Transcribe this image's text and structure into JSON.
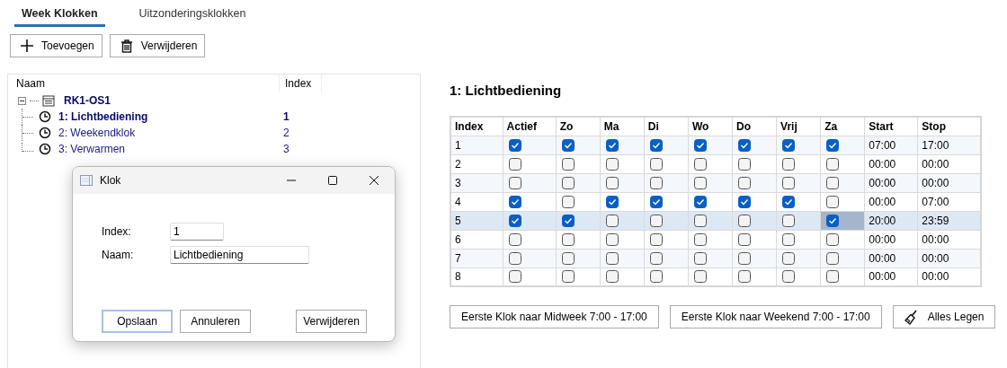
{
  "tabs": [
    {
      "label": "Week Klokken",
      "selected": true
    },
    {
      "label": "Uitzonderingsklokken",
      "selected": false
    }
  ],
  "toolbar": [
    {
      "kind": "add",
      "label": "Toevoegen"
    },
    {
      "kind": "delete",
      "label": "Verwijderen"
    }
  ],
  "tree": {
    "columns": [
      "Naam",
      "Index"
    ],
    "root": {
      "label": "RK1-OS1",
      "expanded": true,
      "children": [
        {
          "label": "1: Lichtbediening",
          "index": "1",
          "selected": true
        },
        {
          "label": "2: Weekendklok",
          "index": "2",
          "selected": false
        },
        {
          "label": "3: Verwarmen",
          "index": "3",
          "selected": false
        }
      ]
    }
  },
  "schedule": {
    "title": "1: Lichtbediening",
    "columns": [
      "Index",
      "Actief",
      "Zo",
      "Ma",
      "Di",
      "Wo",
      "Do",
      "Vrij",
      "Za",
      "Start",
      "Stop"
    ],
    "rows": [
      {
        "index": "1",
        "selected": false,
        "checks": [
          {
            "checked": true,
            "focused": false
          },
          {
            "checked": true,
            "focused": false
          },
          {
            "checked": true,
            "focused": false
          },
          {
            "checked": true,
            "focused": false
          },
          {
            "checked": true,
            "focused": false
          },
          {
            "checked": true,
            "focused": false
          },
          {
            "checked": true,
            "focused": false
          },
          {
            "checked": true,
            "focused": false
          }
        ],
        "start": "07:00",
        "stop": "17:00"
      },
      {
        "index": "2",
        "selected": false,
        "checks": [
          {
            "checked": false,
            "focused": false
          },
          {
            "checked": false,
            "focused": false
          },
          {
            "checked": false,
            "focused": false
          },
          {
            "checked": false,
            "focused": false
          },
          {
            "checked": false,
            "focused": false
          },
          {
            "checked": false,
            "focused": false
          },
          {
            "checked": false,
            "focused": false
          },
          {
            "checked": false,
            "focused": false
          }
        ],
        "start": "00:00",
        "stop": "00:00"
      },
      {
        "index": "3",
        "selected": false,
        "checks": [
          {
            "checked": false,
            "focused": false
          },
          {
            "checked": false,
            "focused": false
          },
          {
            "checked": false,
            "focused": false
          },
          {
            "checked": false,
            "focused": false
          },
          {
            "checked": false,
            "focused": false
          },
          {
            "checked": false,
            "focused": false
          },
          {
            "checked": false,
            "focused": false
          },
          {
            "checked": false,
            "focused": false
          }
        ],
        "start": "00:00",
        "stop": "00:00"
      },
      {
        "index": "4",
        "selected": false,
        "checks": [
          {
            "checked": true,
            "focused": false
          },
          {
            "checked": false,
            "focused": false
          },
          {
            "checked": true,
            "focused": false
          },
          {
            "checked": true,
            "focused": false
          },
          {
            "checked": true,
            "focused": false
          },
          {
            "checked": true,
            "focused": false
          },
          {
            "checked": true,
            "focused": false
          },
          {
            "checked": false,
            "focused": false
          }
        ],
        "start": "00:00",
        "stop": "07:00"
      },
      {
        "index": "5",
        "selected": true,
        "checks": [
          {
            "checked": true,
            "focused": false
          },
          {
            "checked": true,
            "focused": false
          },
          {
            "checked": false,
            "focused": false
          },
          {
            "checked": false,
            "focused": false
          },
          {
            "checked": false,
            "focused": false
          },
          {
            "checked": false,
            "focused": false
          },
          {
            "checked": false,
            "focused": false
          },
          {
            "checked": true,
            "focused": true
          }
        ],
        "start": "20:00",
        "stop": "23:59"
      },
      {
        "index": "6",
        "selected": false,
        "checks": [
          {
            "checked": false,
            "focused": false
          },
          {
            "checked": false,
            "focused": false
          },
          {
            "checked": false,
            "focused": false
          },
          {
            "checked": false,
            "focused": false
          },
          {
            "checked": false,
            "focused": false
          },
          {
            "checked": false,
            "focused": false
          },
          {
            "checked": false,
            "focused": false
          },
          {
            "checked": false,
            "focused": false
          }
        ],
        "start": "00:00",
        "stop": "00:00"
      },
      {
        "index": "7",
        "selected": false,
        "checks": [
          {
            "checked": false,
            "focused": false
          },
          {
            "checked": false,
            "focused": false
          },
          {
            "checked": false,
            "focused": false
          },
          {
            "checked": false,
            "focused": false
          },
          {
            "checked": false,
            "focused": false
          },
          {
            "checked": false,
            "focused": false
          },
          {
            "checked": false,
            "focused": false
          },
          {
            "checked": false,
            "focused": false
          }
        ],
        "start": "00:00",
        "stop": "00:00"
      },
      {
        "index": "8",
        "selected": false,
        "checks": [
          {
            "checked": false,
            "focused": false
          },
          {
            "checked": false,
            "focused": false
          },
          {
            "checked": false,
            "focused": false
          },
          {
            "checked": false,
            "focused": false
          },
          {
            "checked": false,
            "focused": false
          },
          {
            "checked": false,
            "focused": false
          },
          {
            "checked": false,
            "focused": false
          },
          {
            "checked": false,
            "focused": false
          }
        ],
        "start": "00:00",
        "stop": "00:00"
      }
    ],
    "actions": [
      {
        "kind": "preset",
        "label": "Eerste Klok naar Midweek 7:00 - 17:00"
      },
      {
        "kind": "preset",
        "label": "Eerste Klok naar Weekend 7:00 - 17:00"
      },
      {
        "kind": "clear",
        "label": "Alles Legen"
      }
    ]
  },
  "dialog": {
    "title": "Klok",
    "fields": [
      {
        "label": "Index:",
        "value": "1",
        "kind": "short"
      },
      {
        "label": "Naam:",
        "value": "Lichtbediening",
        "kind": "long"
      }
    ],
    "buttons": [
      {
        "label": "Opslaan",
        "default": true
      },
      {
        "label": "Annuleren",
        "default": false
      },
      {
        "label": "Verwijderen",
        "default": false
      }
    ]
  }
}
